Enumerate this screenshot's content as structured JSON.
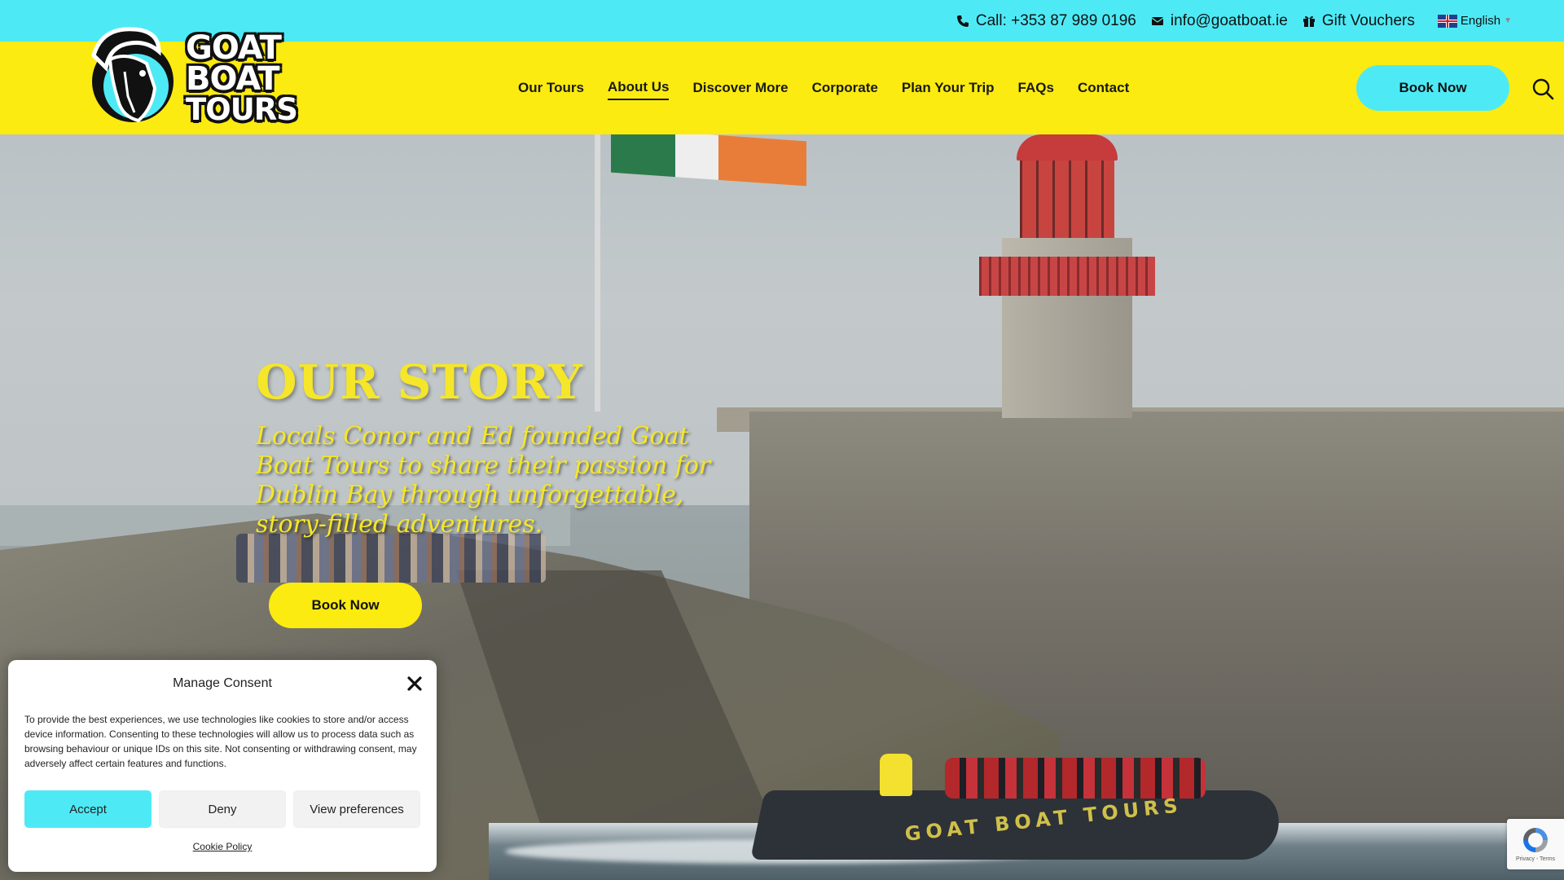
{
  "topbar": {
    "phone": "Call: +353 87 989 0196",
    "email": "info@goatboat.ie",
    "gift": "Gift Vouchers",
    "language": "English",
    "phone_icon": "phone-icon",
    "email_icon": "envelope-icon",
    "gift_icon": "gift-icon"
  },
  "logo": {
    "line1": "GOAT",
    "line2": "BOAT",
    "line3": "TOURS"
  },
  "nav": {
    "items": [
      {
        "label": "Our Tours"
      },
      {
        "label": "About Us",
        "active": true
      },
      {
        "label": "Discover More"
      },
      {
        "label": "Corporate"
      },
      {
        "label": "Plan Your Trip"
      },
      {
        "label": "FAQs"
      },
      {
        "label": "Contact"
      }
    ],
    "book_label": "Book Now"
  },
  "hero": {
    "title": "OUR STORY",
    "subtitle": "Locals Conor and Ed founded Goat Boat Tours to share their passion for Dublin Bay through unforgettable, story-filled adventures.",
    "button": "Book Now",
    "boat_text": "GOAT BOAT TOURS"
  },
  "consent": {
    "title": "Manage Consent",
    "body": "To provide the best experiences, we use technologies like cookies to store and/or access device information. Consenting to these technologies will allow us to process data such as browsing behaviour or unique IDs on this site. Not consenting or withdrawing consent, may adversely affect certain features and functions.",
    "accept": "Accept",
    "deny": "Deny",
    "preferences": "View preferences",
    "cookie_policy": "Cookie Policy"
  },
  "recaptcha": {
    "links": "Privacy - Terms"
  },
  "colors": {
    "cyan": "#4deaf6",
    "yellow": "#fbeb10",
    "title_yellow": "#f5e62a"
  }
}
